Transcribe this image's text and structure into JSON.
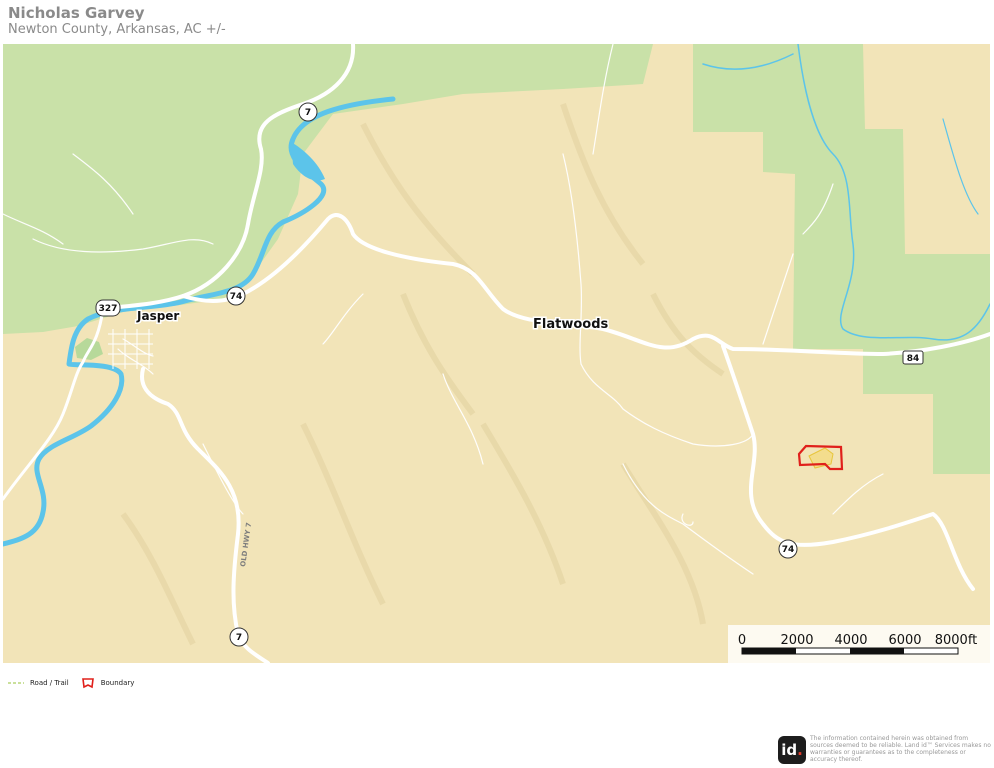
{
  "header": {
    "title": "Nicholas Garvey",
    "subtitle": "Newton County, Arkansas,  AC +/-"
  },
  "map": {
    "colors": {
      "land": "#f2e4b8",
      "forest": "#c9e1a8",
      "water": "#5cc4ea",
      "road": "#ffffff",
      "boundary": "#e0201b",
      "parcel_fill": "#f5d24e"
    },
    "places": {
      "jasper": "Jasper",
      "flatwoods": "Flatwoods"
    },
    "road_label": "OLD HWY 7",
    "shields": {
      "hwy7_north": "7",
      "hwy327": "327",
      "hwy74_west": "74",
      "hwy84": "84",
      "hwy74_east": "74",
      "hwy7_south": "7"
    },
    "scale_bar": {
      "labels": [
        "0",
        "2000",
        "4000",
        "6000",
        "8000ft"
      ]
    }
  },
  "legend": {
    "road_trail": "Road / Trail",
    "boundary": "Boundary"
  },
  "footer": {
    "logo_text": "id",
    "disclaimer": "The information contained herein was obtained from sources deemed to be reliable. Land id™ Services makes no warranties or guarantees as to the completeness or accuracy thereof."
  }
}
